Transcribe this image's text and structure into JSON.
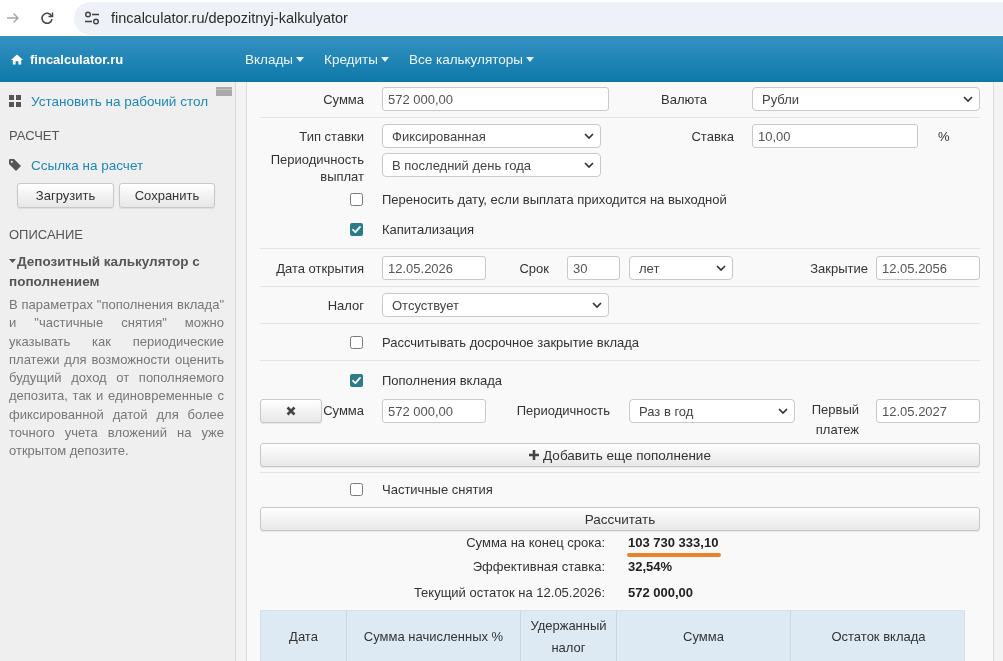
{
  "browser": {
    "url": "fincalculator.ru/depozitnyj-kalkulyator"
  },
  "navbar": {
    "brand": "fincalculator.ru",
    "menu": [
      {
        "label": "Вклады"
      },
      {
        "label": "Кредиты"
      },
      {
        "label": "Все калькуляторы"
      }
    ]
  },
  "sidebar": {
    "install_link": "Установить на рабочий стол",
    "calculation": {
      "heading": "РАСЧЕТ",
      "link": "Ссылка на расчет",
      "buttons": [
        "Загрузить",
        "Сохранить"
      ]
    },
    "description": {
      "heading": "ОПИСАНИЕ",
      "title": "Депозитный калькулятор с пополнением",
      "expanded": true,
      "text": "В параметрах \"пополнения вклада\" и \"частичные снятия\" можно указывать как периодические платежи для возможности оценить будущий доход от пополняемого депозита, так и единовременные с фиксированной датой для более точного учета вложений на уже открытом депозите."
    }
  },
  "form": {
    "amount": {
      "label": "Сумма",
      "value": "572 000,00"
    },
    "currency": {
      "label": "Валюта",
      "value": "Рубли"
    },
    "rate_type": {
      "label": "Тип ставки",
      "value": "Фиксированная"
    },
    "rate": {
      "label": "Ставка",
      "value": "10,00",
      "unit": "%"
    },
    "payout_frequency": {
      "label": "Периодичность выплат",
      "value": "В последний день года"
    },
    "shift_weekend_date": {
      "label": "Переносить дату, если выплата приходится на выходной",
      "checked": false
    },
    "capitalization": {
      "label": "Капитализация",
      "checked": true
    },
    "open_date": {
      "label": "Дата открытия",
      "value": "12.05.2026"
    },
    "term": {
      "label": "Срок",
      "value": "30",
      "unit": "лет"
    },
    "close_date": {
      "label": "Закрытие",
      "value": "12.05.2056"
    },
    "tax": {
      "label": "Налог",
      "value": "Отсуствует"
    },
    "early_closing": {
      "label": "Рассчитывать досрочное закрытие вклада",
      "checked": false
    },
    "top_ups": {
      "label": "Пополнения вклада",
      "checked": true,
      "items": [
        {
          "amount": {
            "label": "Сумма",
            "value": "572 000,00"
          },
          "frequency": {
            "label": "Периодичность",
            "value": "Раз в год"
          },
          "first_payment": {
            "label": "Первый платеж",
            "value": "12.05.2027"
          }
        }
      ],
      "add_button": "Добавить еще пополнение"
    },
    "partial_withdrawals": {
      "label": "Частичные снятия",
      "checked": false
    },
    "calculate_button": "Рассчитать"
  },
  "results": [
    {
      "label": "Сумма на конец срока:",
      "value": "103 730 333,10",
      "highlighted": true
    },
    {
      "label": "Эффективная ставка:",
      "value": "32,54%",
      "highlighted": false
    },
    {
      "label": "Текущий остаток на 12.05.2026:",
      "value": "572 000,00",
      "highlighted": false
    }
  ],
  "schedule_table": {
    "columns": [
      "Дата",
      "Сумма начисленных %",
      "Удержанный налог",
      "Сумма",
      "Остаток вклада"
    ]
  }
}
